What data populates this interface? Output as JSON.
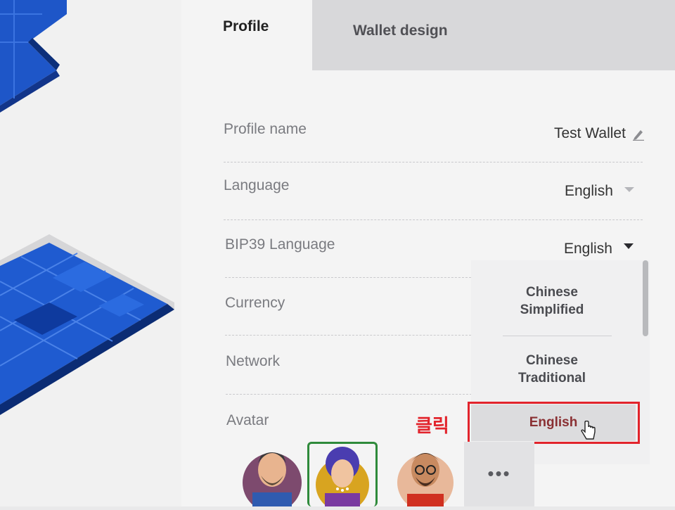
{
  "tabs": [
    {
      "label": "Profile",
      "active": true
    },
    {
      "label": "Wallet design",
      "active": false
    }
  ],
  "rows": {
    "profile_name": {
      "label": "Profile name",
      "value": "Test Wallet",
      "icon": "pencil-icon"
    },
    "language": {
      "label": "Language",
      "value": "English"
    },
    "bip39_language": {
      "label": "BIP39 Language",
      "value": "English"
    },
    "currency": {
      "label": "Currency"
    },
    "network": {
      "label": "Network"
    },
    "avatar": {
      "label": "Avatar"
    }
  },
  "dropdown": {
    "options": [
      {
        "line1": "Chinese",
        "line2": "Simplified"
      },
      {
        "line1": "Chinese",
        "line2": "Traditional"
      },
      {
        "line1": "English",
        "line2": ""
      }
    ],
    "selected": "English"
  },
  "annotation": {
    "text": "클릭",
    "color": "#e2242c"
  },
  "avatars": {
    "count": 3,
    "selected_index": 1,
    "more_label": "•••"
  },
  "colors": {
    "accent_red": "#e2242c",
    "selected_green": "#2f8a3b",
    "art_blue": "#1f5bd0"
  }
}
